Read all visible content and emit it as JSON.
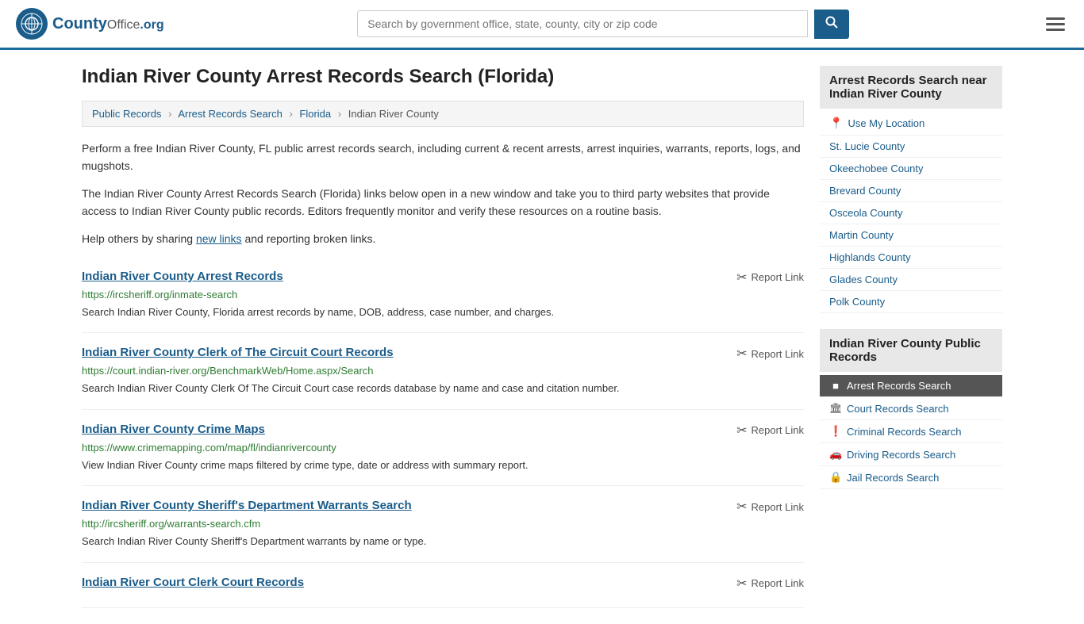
{
  "header": {
    "logo_text": "CountyOffice",
    "logo_suffix": ".org",
    "search_placeholder": "Search by government office, state, county, city or zip code",
    "search_value": ""
  },
  "page": {
    "title": "Indian River County Arrest Records Search (Florida)",
    "breadcrumb": {
      "items": [
        {
          "label": "Public Records",
          "href": "#"
        },
        {
          "label": "Arrest Records Search",
          "href": "#"
        },
        {
          "label": "Florida",
          "href": "#"
        },
        {
          "label": "Indian River County",
          "href": "#"
        }
      ]
    },
    "description1": "Perform a free Indian River County, FL public arrest records search, including current & recent arrests, arrest inquiries, warrants, reports, logs, and mugshots.",
    "description2": "The Indian River County Arrest Records Search (Florida) links below open in a new window and take you to third party websites that provide access to Indian River County public records. Editors frequently monitor and verify these resources on a routine basis.",
    "description3_prefix": "Help others by sharing ",
    "description3_link": "new links",
    "description3_suffix": " and reporting broken links.",
    "records": [
      {
        "title": "Indian River County Arrest Records",
        "url": "https://ircsheriff.org/inmate-search",
        "desc": "Search Indian River County, Florida arrest records by name, DOB, address, case number, and charges.",
        "report_label": "Report Link"
      },
      {
        "title": "Indian River County Clerk of The Circuit Court Records",
        "url": "https://court.indian-river.org/BenchmarkWeb/Home.aspx/Search",
        "desc": "Search Indian River County Clerk Of The Circuit Court case records database by name and case and citation number.",
        "report_label": "Report Link"
      },
      {
        "title": "Indian River County Crime Maps",
        "url": "https://www.crimemapping.com/map/fl/indianrivercounty",
        "desc": "View Indian River County crime maps filtered by crime type, date or address with summary report.",
        "report_label": "Report Link"
      },
      {
        "title": "Indian River County Sheriff's Department Warrants Search",
        "url": "http://ircsheriff.org/warrants-search.cfm",
        "desc": "Search Indian River County Sheriff's Department warrants by name or type.",
        "report_label": "Report Link"
      },
      {
        "title": "Indian River Court Clerk Court Records",
        "url": "",
        "desc": "",
        "report_label": "Report Link"
      }
    ]
  },
  "sidebar": {
    "nearby_heading": "Arrest Records Search near Indian River County",
    "nearby_items": [
      {
        "label": "Use My Location",
        "icon": "📍",
        "href": "#"
      },
      {
        "label": "St. Lucie County",
        "href": "#"
      },
      {
        "label": "Okeechobee County",
        "href": "#"
      },
      {
        "label": "Brevard County",
        "href": "#"
      },
      {
        "label": "Osceola County",
        "href": "#"
      },
      {
        "label": "Martin County",
        "href": "#"
      },
      {
        "label": "Highlands County",
        "href": "#"
      },
      {
        "label": "Glades County",
        "href": "#"
      },
      {
        "label": "Polk County",
        "href": "#"
      }
    ],
    "public_records_heading": "Indian River County Public Records",
    "public_records_items": [
      {
        "label": "Arrest Records Search",
        "icon": "■",
        "active": true,
        "href": "#"
      },
      {
        "label": "Court Records Search",
        "icon": "🏛",
        "active": false,
        "href": "#"
      },
      {
        "label": "Criminal Records Search",
        "icon": "❗",
        "active": false,
        "href": "#"
      },
      {
        "label": "Driving Records Search",
        "icon": "🚗",
        "active": false,
        "href": "#"
      },
      {
        "label": "Jail Records Search",
        "icon": "🔒",
        "active": false,
        "href": "#"
      }
    ]
  }
}
